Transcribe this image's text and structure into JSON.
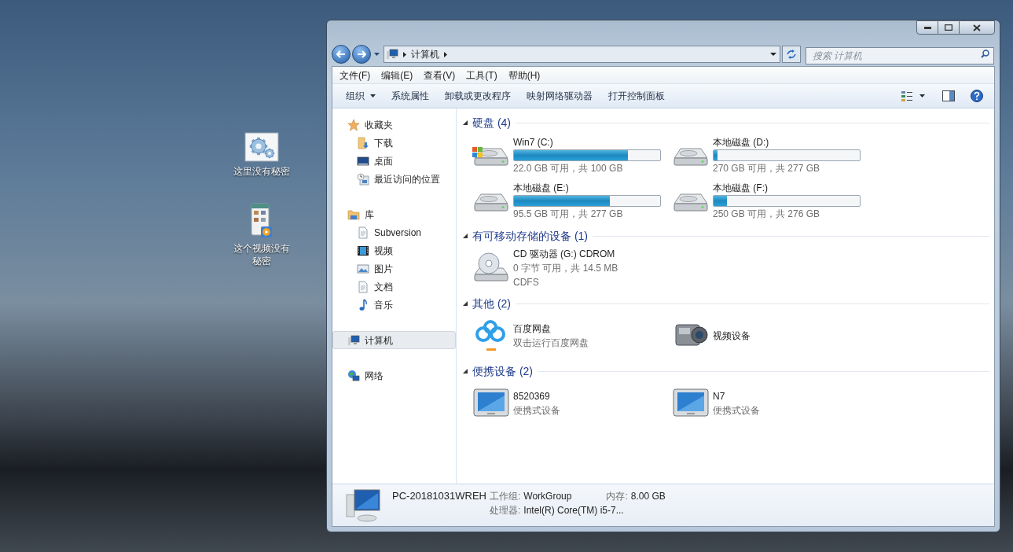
{
  "desktop": {
    "icons": [
      {
        "kind": "settings",
        "label": "这里没有秘密"
      },
      {
        "kind": "video",
        "label": "这个视频没有秘密"
      }
    ]
  },
  "window": {
    "address": {
      "path": [
        "计算机"
      ]
    },
    "search": {
      "placeholder": "搜索 计算机"
    }
  },
  "menu": [
    "文件(F)",
    "编辑(E)",
    "查看(V)",
    "工具(T)",
    "帮助(H)"
  ],
  "toolbar": [
    {
      "label": "组织",
      "dropdown": true
    },
    {
      "label": "系统属性",
      "dropdown": false
    },
    {
      "label": "卸载或更改程序",
      "dropdown": false
    },
    {
      "label": "映射网络驱动器",
      "dropdown": false
    },
    {
      "label": "打开控制面板",
      "dropdown": false
    }
  ],
  "nav": [
    {
      "label": "收藏夹",
      "kind": "star",
      "selected": false,
      "children": [
        {
          "label": "下载",
          "kind": "download",
          "selected": false
        },
        {
          "label": "桌面",
          "kind": "desktop",
          "selected": false
        },
        {
          "label": "最近访问的位置",
          "kind": "recent",
          "selected": false
        }
      ]
    },
    {
      "label": "库",
      "kind": "library",
      "selected": false,
      "children": [
        {
          "label": "Subversion",
          "kind": "doc",
          "selected": false
        },
        {
          "label": "视频",
          "kind": "film",
          "selected": false
        },
        {
          "label": "图片",
          "kind": "picture",
          "selected": false
        },
        {
          "label": "文档",
          "kind": "doc",
          "selected": false
        },
        {
          "label": "音乐",
          "kind": "music",
          "selected": false
        }
      ]
    },
    {
      "label": "计算机",
      "kind": "computer",
      "selected": true
    },
    {
      "label": "网络",
      "kind": "network",
      "selected": false
    }
  ],
  "sections": [
    {
      "title": "硬盘",
      "count": "(4)",
      "items": [
        {
          "kind": "system-drive",
          "name": "Win7 (C:)",
          "level": 0.78,
          "lines": [
            "22.0 GB 可用，共 100 GB"
          ]
        },
        {
          "kind": "drive",
          "name": "本地磁盘 (D:)",
          "level": 0.025,
          "lines": [
            "270 GB 可用，共 277 GB"
          ]
        },
        {
          "kind": "drive",
          "name": "本地磁盘 (E:)",
          "level": 0.655,
          "lines": [
            "95.5 GB 可用，共 277 GB"
          ]
        },
        {
          "kind": "drive",
          "name": "本地磁盘 (F:)",
          "level": 0.094,
          "lines": [
            "250 GB 可用，共 276 GB"
          ]
        }
      ]
    },
    {
      "title": "有可移动存储的设备",
      "count": "(1)",
      "items": [
        {
          "kind": "cd",
          "name": "CD 驱动器 (G:) CDROM",
          "lines": [
            "0 字节 可用，共 14.5 MB",
            "CDFS"
          ]
        }
      ]
    },
    {
      "title": "其他",
      "count": "(2)",
      "items": [
        {
          "kind": "cloud",
          "name": "百度网盘",
          "lines": [
            "双击运行百度网盘"
          ]
        },
        {
          "kind": "camera",
          "name": "视频设备"
        }
      ]
    },
    {
      "title": "便携设备",
      "count": "(2)",
      "items": [
        {
          "kind": "portable",
          "name": "8520369",
          "lines": [
            "便携式设备"
          ]
        },
        {
          "kind": "portable",
          "name": "N7",
          "lines": [
            "便携式设备"
          ]
        }
      ]
    }
  ],
  "details": {
    "name": "PC-20181031WREH",
    "fields": [
      {
        "label": "工作组:",
        "value": "WorkGroup"
      },
      {
        "label": "内存:",
        "value": "8.00 GB"
      },
      {
        "label": "处理器:",
        "value": "Intel(R) Core(TM) i5-7..."
      }
    ]
  }
}
